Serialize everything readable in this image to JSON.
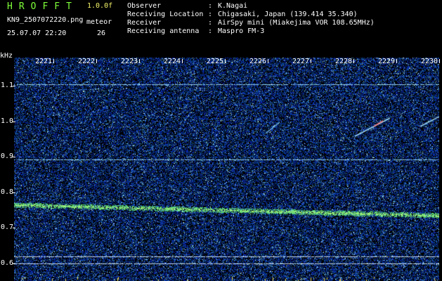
{
  "header": {
    "brand": "HROFFT",
    "version": "1.0.0f",
    "filename": "KN9_2507072220.png",
    "timestamp": "25.07.07 22:20",
    "meteor_label": "meteor",
    "meteor_count": "26"
  },
  "station": [
    {
      "key": "Observer",
      "value": "K.Nagai"
    },
    {
      "key": "Receiving Location",
      "value": "Chigasaki, Japan (139.414 35.340)"
    },
    {
      "key": "Receiver",
      "value": "AirSpy mini (Miakejima VOR 108.65MHz)"
    },
    {
      "key": "Receiving antenna",
      "value": "Maspro FM-3"
    }
  ],
  "spectrogram": {
    "y_unit": "kHz",
    "y_ticks": [
      "1.1",
      "1.0",
      "0.9",
      "0.8",
      "0.7",
      "0.6"
    ],
    "x_ticks": [
      "2221",
      "2222",
      "2223",
      "2224",
      "2225",
      "2226",
      "2227",
      "2228",
      "2229",
      "2230"
    ],
    "ylim": [
      0.55,
      1.18
    ],
    "colors": {
      "background": "#000000",
      "noise_blue": "#1a3fb0",
      "carrier": "#7fd6ff",
      "echo": "#8cff6a"
    }
  }
}
